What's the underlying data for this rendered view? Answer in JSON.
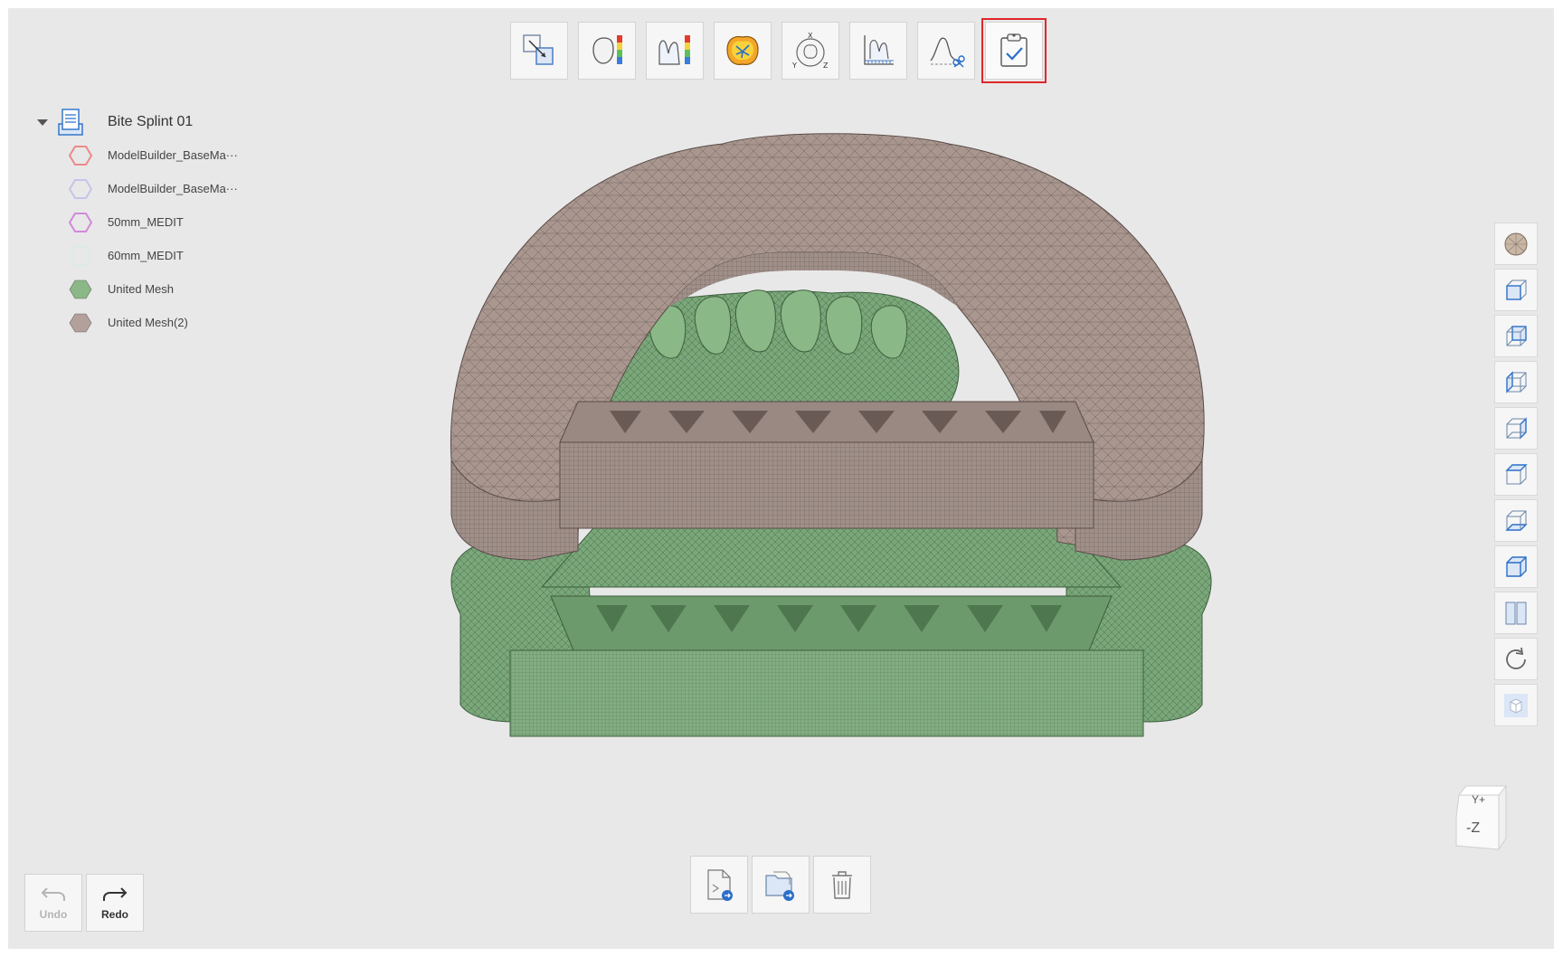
{
  "project": {
    "title": "Bite Splint 01",
    "items": [
      {
        "label": "ModelBuilder_BaseMa···",
        "color": "#ec8a8a",
        "filled": false
      },
      {
        "label": "ModelBuilder_BaseMa···",
        "color": "#c4c4ec",
        "filled": false
      },
      {
        "label": "50mm_MEDIT",
        "color": "#d08ad8",
        "filled": false
      },
      {
        "label": "60mm_MEDIT",
        "color": "#dfe9e9",
        "filled": false
      },
      {
        "label": "United Mesh",
        "color": "#8ab886",
        "filled": true
      },
      {
        "label": "United Mesh(2)",
        "color": "#b4a09a",
        "filled": true
      }
    ]
  },
  "top_toolbar": {
    "tools": [
      {
        "icon": "align-tool-icon"
      },
      {
        "icon": "deviation-map-icon"
      },
      {
        "icon": "cross-section-deviation-icon"
      },
      {
        "icon": "occlusion-analysis-icon"
      },
      {
        "icon": "xyz-orientation-icon"
      },
      {
        "icon": "measure-tool-icon"
      },
      {
        "icon": "trim-tool-icon"
      },
      {
        "icon": "complete-icon",
        "active": true
      }
    ]
  },
  "view_toolbar": {
    "buttons": [
      {
        "icon": "mesh-display-icon"
      },
      {
        "icon": "front-view-icon"
      },
      {
        "icon": "back-view-icon"
      },
      {
        "icon": "left-view-icon"
      },
      {
        "icon": "right-view-icon"
      },
      {
        "icon": "top-view-icon"
      },
      {
        "icon": "bottom-view-icon"
      },
      {
        "icon": "iso-view-icon"
      },
      {
        "icon": "split-view-icon"
      },
      {
        "icon": "reset-view-icon"
      },
      {
        "icon": "transparency-icon"
      }
    ]
  },
  "nav_cube": {
    "top_label": "Y+",
    "front_label": "-Z"
  },
  "bottom_toolbar": {
    "buttons": [
      {
        "icon": "export-file-icon"
      },
      {
        "icon": "open-folder-icon"
      },
      {
        "icon": "delete-icon"
      }
    ]
  },
  "history": {
    "undo_label": "Undo",
    "redo_label": "Redo"
  },
  "colors": {
    "splint": "#a9968f",
    "model": "#7aa77a",
    "active_outline": "#e0262b",
    "background": "#e8e8e8"
  }
}
